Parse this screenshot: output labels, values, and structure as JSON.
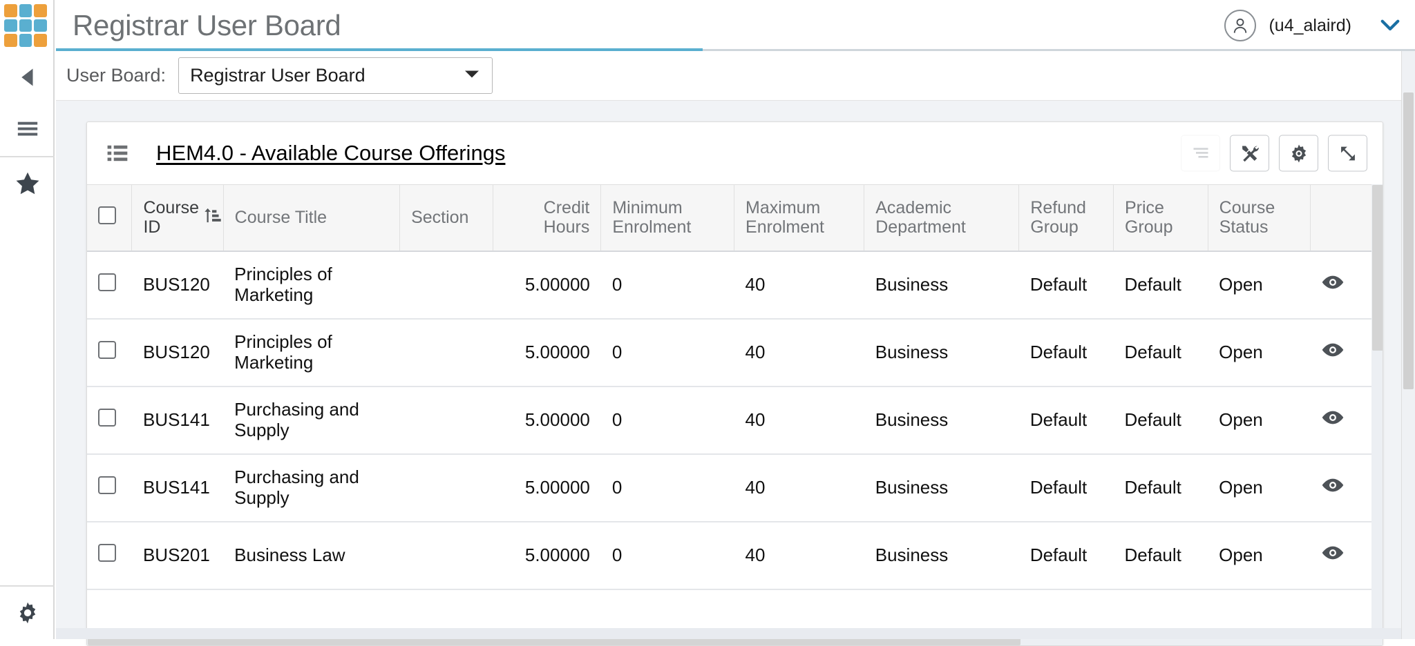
{
  "header": {
    "app_title": "Registrar User Board",
    "logo_name": "app-logo",
    "logo_colors": [
      "#eda03c",
      "#5aafd0",
      "#eda03c",
      "#5aafd0",
      "#5aafd0",
      "#5aafd0",
      "#eda03c",
      "#5aafd0",
      "#eda03c"
    ],
    "accent_color": "#5aafd0",
    "user_name": "(u4_alaird)"
  },
  "sidebar": {
    "items": [
      {
        "name": "collapse-panel",
        "icon": "triangle-left-icon"
      },
      {
        "name": "menu",
        "icon": "hamburger-icon"
      },
      {
        "name": "favorites",
        "icon": "star-icon"
      }
    ],
    "bottom": {
      "name": "settings",
      "icon": "gear-icon"
    }
  },
  "toolbar": {
    "board_label": "User Board:",
    "board_selected": "Registrar User Board",
    "board_options": [
      "Registrar User Board"
    ]
  },
  "card": {
    "title": "HEM4.0 - Available Course Offerings",
    "list_icon": "list-icon",
    "actions": [
      {
        "name": "align-lines-button",
        "icon": "lines-icon",
        "disabled": true
      },
      {
        "name": "tools-button",
        "icon": "tools-icon",
        "disabled": false
      },
      {
        "name": "settings-button",
        "icon": "gear-icon",
        "disabled": false
      },
      {
        "name": "expand-button",
        "icon": "expand-arrows-icon",
        "disabled": false
      }
    ]
  },
  "table": {
    "sort_column": "Course ID",
    "sort_direction": "ascending",
    "columns": [
      {
        "label": "",
        "key": "select",
        "align": "left",
        "type": "checkbox"
      },
      {
        "label": "Course\nID",
        "key": "course_id",
        "align": "left",
        "sorted": true
      },
      {
        "label": "Course Title",
        "key": "course_title",
        "align": "left"
      },
      {
        "label": "Section",
        "key": "section",
        "align": "left"
      },
      {
        "label": "Credit\nHours",
        "key": "credit_hours",
        "align": "right"
      },
      {
        "label": "Minimum\nEnrolment",
        "key": "min_enrolment",
        "align": "left"
      },
      {
        "label": "Maximum\nEnrolment",
        "key": "max_enrolment",
        "align": "left"
      },
      {
        "label": "Academic\nDepartment",
        "key": "academic_department",
        "align": "left"
      },
      {
        "label": "Refund\nGroup",
        "key": "refund_group",
        "align": "left"
      },
      {
        "label": "Price\nGroup",
        "key": "price_group",
        "align": "left"
      },
      {
        "label": "Course\nStatus",
        "key": "course_status",
        "align": "left"
      },
      {
        "label": "",
        "key": "view",
        "align": "left",
        "type": "icon"
      }
    ],
    "rows": [
      {
        "course_id": "BUS120",
        "course_title": "Principles of Marketing",
        "section": "",
        "credit_hours": "5.00000",
        "min_enrolment": "0",
        "max_enrolment": "40",
        "academic_department": "Business",
        "refund_group": "Default",
        "price_group": "Default",
        "course_status": "Open",
        "view_icon": "eye-icon"
      },
      {
        "course_id": "BUS120",
        "course_title": "Principles of Marketing",
        "section": "",
        "credit_hours": "5.00000",
        "min_enrolment": "0",
        "max_enrolment": "40",
        "academic_department": "Business",
        "refund_group": "Default",
        "price_group": "Default",
        "course_status": "Open",
        "view_icon": "eye-icon"
      },
      {
        "course_id": "BUS141",
        "course_title": "Purchasing and Supply",
        "section": "",
        "credit_hours": "5.00000",
        "min_enrolment": "0",
        "max_enrolment": "40",
        "academic_department": "Business",
        "refund_group": "Default",
        "price_group": "Default",
        "course_status": "Open",
        "view_icon": "eye-icon"
      },
      {
        "course_id": "BUS141",
        "course_title": "Purchasing and Supply",
        "section": "",
        "credit_hours": "5.00000",
        "min_enrolment": "0",
        "max_enrolment": "40",
        "academic_department": "Business",
        "refund_group": "Default",
        "price_group": "Default",
        "course_status": "Open",
        "view_icon": "eye-icon"
      },
      {
        "course_id": "BUS201",
        "course_title": "Business Law",
        "section": "",
        "credit_hours": "5.00000",
        "min_enrolment": "0",
        "max_enrolment": "40",
        "academic_department": "Business",
        "refund_group": "Default",
        "price_group": "Default",
        "course_status": "Open",
        "view_icon": "eye-icon"
      }
    ]
  }
}
